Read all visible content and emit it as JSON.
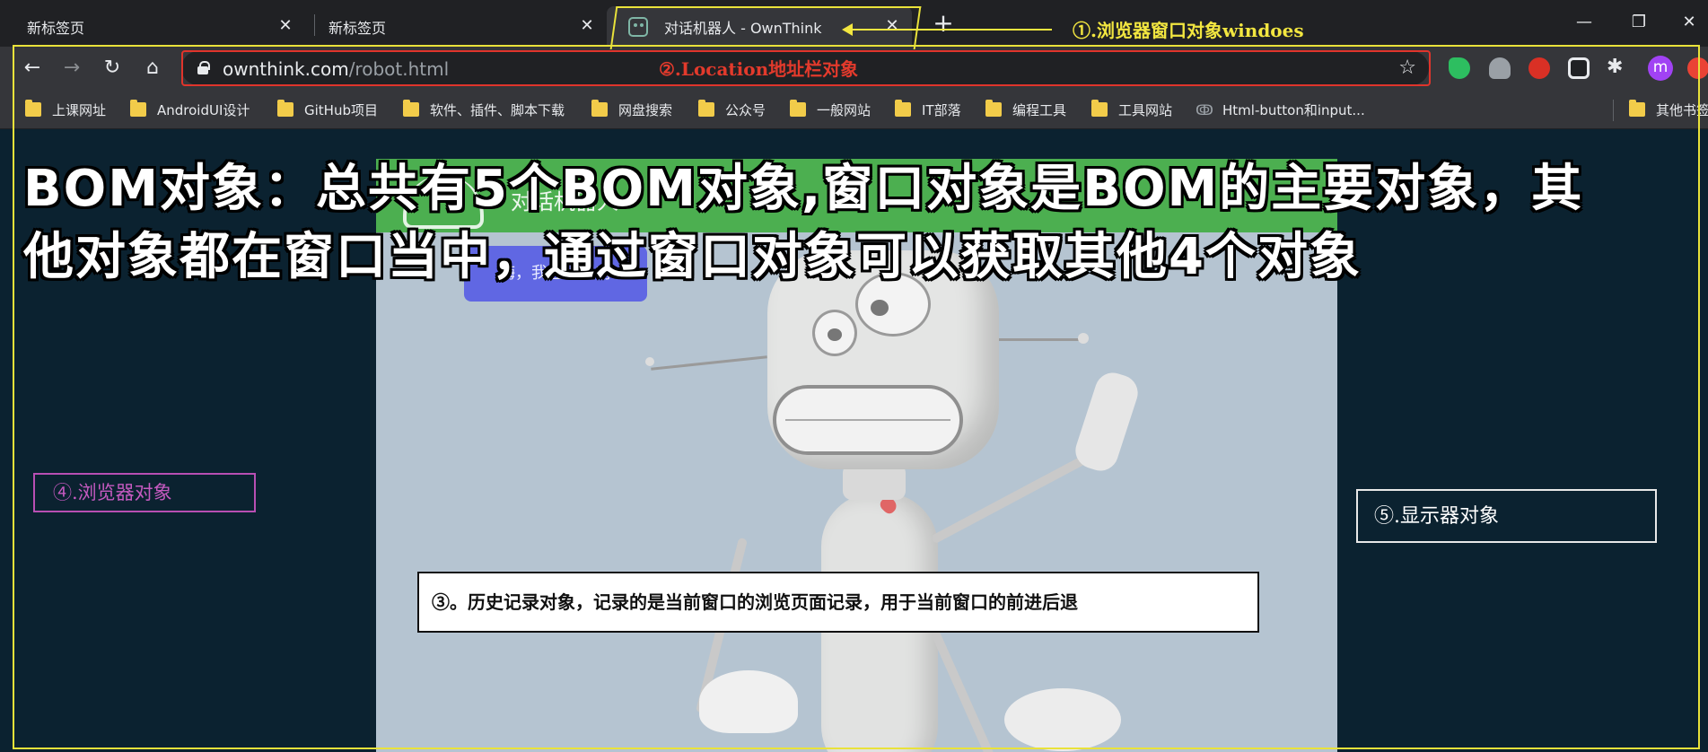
{
  "tabs": [
    {
      "label": "新标签页",
      "active": false
    },
    {
      "label": "新标签页",
      "active": false
    },
    {
      "label": "对话机器人 - OwnThink",
      "active": true
    }
  ],
  "tab_close_glyph": "✕",
  "newtab_glyph": "+",
  "window_controls": {
    "minimize": "—",
    "restore": "❐",
    "close": "✕"
  },
  "toolbar": {
    "back_icon": "←",
    "forward_icon": "→",
    "reload_icon": "↻",
    "home_icon": "⌂",
    "url_host": "ownthink.com",
    "url_path": "/robot.html",
    "bookmark_star": "☆",
    "profile_initial": "m",
    "extensions_icon": "✱"
  },
  "bookmarks": [
    {
      "label": "上课网址",
      "icon": "folder-icon"
    },
    {
      "label": "AndroidUI设计",
      "icon": "folder-icon"
    },
    {
      "label": "GitHub项目",
      "icon": "folder-icon"
    },
    {
      "label": "软件、插件、脚本下载",
      "icon": "folder-icon"
    },
    {
      "label": "网盘搜索",
      "icon": "folder-icon"
    },
    {
      "label": "公众号",
      "icon": "folder-icon"
    },
    {
      "label": "一般网站",
      "icon": "folder-icon"
    },
    {
      "label": "IT部落",
      "icon": "folder-icon"
    },
    {
      "label": "编程工具",
      "icon": "folder-icon"
    },
    {
      "label": "工具网站",
      "icon": "folder-icon"
    },
    {
      "label": "Html-button和input...",
      "icon": "link-icon"
    },
    {
      "label": "其他书签",
      "icon": "folder-icon"
    }
  ],
  "page": {
    "bubble_text": "嗨，我在呢，有",
    "site_title": "对话机器人",
    "headline_line1": "BOM对象：总共有5个BOM对象,窗口对象是BOM的主要对象，其",
    "headline_line2": "他对象都在窗口当中，通过窗口对象可以获取其他4个对象"
  },
  "annotations": {
    "window": "①.浏览器窗口对象windoes",
    "location": "②.Location地址栏对象",
    "history": "③。历史记录对象，记录的是当前窗口的浏览页面记录，用于当前窗口的前进后退",
    "navigator": "④.浏览器对象",
    "screen": "⑤.显示器对象"
  },
  "colors": {
    "annotation_yellow": "#e9e23a",
    "annotation_red": "#e0342b",
    "annotation_purple": "#b84fb3",
    "page_background": "#0b2230",
    "green_bar": "#4caf50",
    "bubble": "#6067e3"
  }
}
